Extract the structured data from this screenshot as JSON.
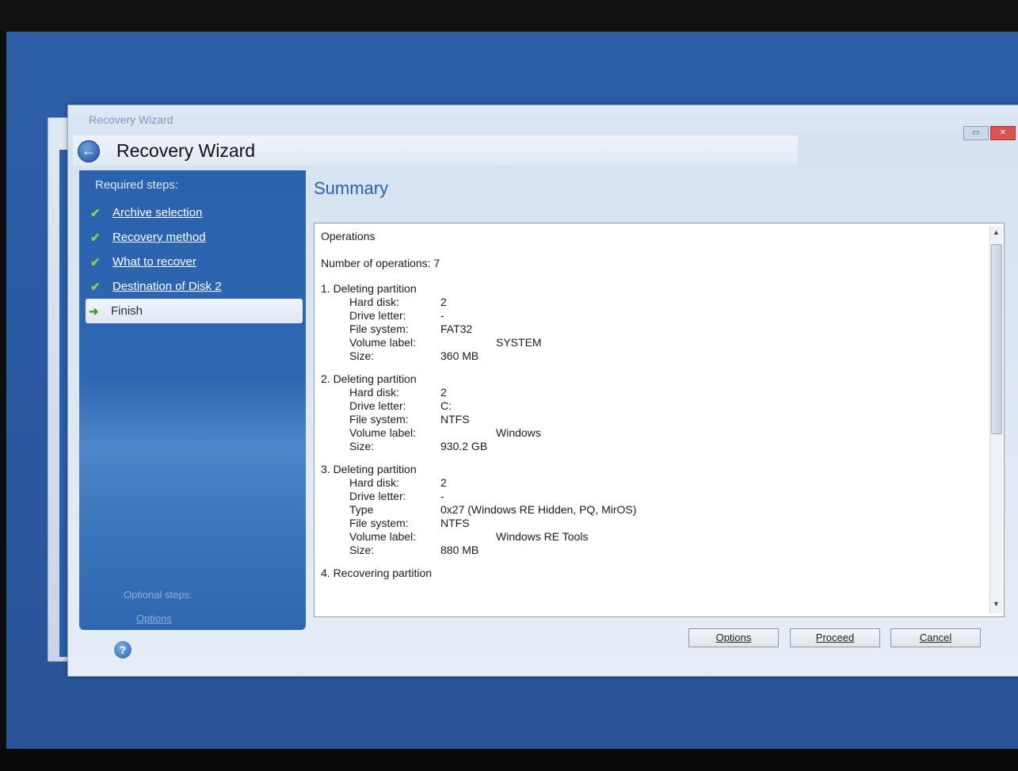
{
  "window": {
    "titlebar_text": "Recovery Wizard",
    "title": "Recovery Wizard",
    "restore_icon": "restore-icon",
    "close_icon": "close-icon"
  },
  "sidebar": {
    "heading": "Required steps:",
    "steps": [
      {
        "label": "Archive selection",
        "status": "done"
      },
      {
        "label": "Recovery method",
        "status": "done"
      },
      {
        "label": "What to recover",
        "status": "done"
      },
      {
        "label": "Destination of Disk 2",
        "status": "done"
      },
      {
        "label": "Finish",
        "status": "current"
      }
    ],
    "optional_heading": "Optional steps:",
    "optional_link": "Options"
  },
  "main": {
    "title": "Summary",
    "operations_title": "Operations",
    "operations_count": "Number of operations: 7",
    "operations": [
      {
        "title": "1. Deleting partition",
        "props": [
          {
            "key": "Hard disk:",
            "value": "2"
          },
          {
            "key": "Drive letter:",
            "value": "-"
          },
          {
            "key": "File system:",
            "value": "FAT32"
          },
          {
            "key": "Volume label:",
            "value": "SYSTEM"
          },
          {
            "key": "Size:",
            "value": "360 MB"
          }
        ]
      },
      {
        "title": "2. Deleting partition",
        "props": [
          {
            "key": "Hard disk:",
            "value": "2"
          },
          {
            "key": "Drive letter:",
            "value": "C:"
          },
          {
            "key": "File system:",
            "value": "NTFS"
          },
          {
            "key": "Volume label:",
            "value": "Windows"
          },
          {
            "key": "Size:",
            "value": "930.2 GB"
          }
        ]
      },
      {
        "title": "3. Deleting partition",
        "props": [
          {
            "key": "Hard disk:",
            "value": "2"
          },
          {
            "key": "Drive letter:",
            "value": "-"
          },
          {
            "key": "Type",
            "value": "0x27 (Windows RE Hidden, PQ, MirOS)"
          },
          {
            "key": "File system:",
            "value": "NTFS"
          },
          {
            "key": "Volume label:",
            "value": "Windows RE Tools"
          },
          {
            "key": "Size:",
            "value": "880 MB"
          }
        ]
      },
      {
        "title": "4. Recovering partition",
        "props": []
      }
    ]
  },
  "buttons": {
    "options": "Options",
    "proceed": "Proceed",
    "cancel": "Cancel"
  },
  "colors": {
    "desktop": "#2d5fa8",
    "sidebar": "#2f66b1",
    "accent_title": "#2660b0",
    "check": "#8cd44a"
  }
}
